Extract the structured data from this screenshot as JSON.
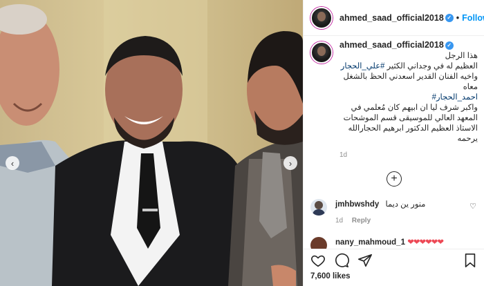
{
  "post": {
    "username": "ahmed_saad_official2018",
    "follow_label": "Follow",
    "separator": "•",
    "verified_mark": "✓",
    "likes": "7,600 likes",
    "caption": {
      "lines": [
        "هذا الرجل",
        "العظيم له في وجداني الكثير ",
        "واخيه الفنان القدير اسعدني الحظ بالشغل",
        "معاه",
        "",
        "واكبر شرف ليا ان ابيهم كان مُعلمي في",
        "المعهد العالي للموسيقى قسم الموشحات",
        "الاستاذ العظيم الدكتور ابرهيم الحجارالله",
        "يرحمه"
      ],
      "tag1": "#علي_الحجار",
      "tag2": "احمد_الحجار#",
      "time": "1d"
    },
    "comments": [
      {
        "username": "jmhbwshdy",
        "text": "منور ين ديما",
        "time": "1d",
        "reply": "Reply"
      },
      {
        "username": "nany_mahmoud_1",
        "text": "❤❤❤❤❤❤"
      }
    ]
  },
  "icons": {
    "more": "plus-circle",
    "actions": [
      "heart-icon",
      "comment-icon",
      "share-icon",
      "bookmark-icon"
    ],
    "carousel": [
      "chevron-left-icon",
      "chevron-right-icon"
    ]
  },
  "colors": {
    "link": "#00376b",
    "follow": "#0095f6",
    "verified": "#3897f0",
    "heart": "#ed4956"
  }
}
